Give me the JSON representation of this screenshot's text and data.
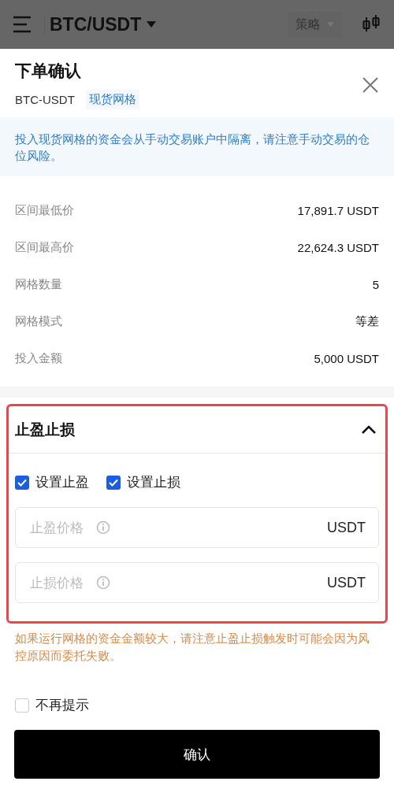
{
  "top_bar": {
    "pair": "BTC/USDT",
    "mode": "策略"
  },
  "dialog": {
    "title": "下单确认",
    "symbol": "BTC-USDT",
    "tag": "现货网格",
    "notice": "投入现货网格的资金会从手动交易账户中隔离，请注意手动交易的仓位风险。"
  },
  "details": [
    {
      "label": "区间最低价",
      "value": "17,891.7 USDT"
    },
    {
      "label": "区间最高价",
      "value": "22,624.3 USDT"
    },
    {
      "label": "网格数量",
      "value": "5"
    },
    {
      "label": "网格模式",
      "value": "等差"
    },
    {
      "label": "投入金额",
      "value": "5,000 USDT"
    }
  ],
  "tp_sl": {
    "title": "止盈止损",
    "expanded": true,
    "highlighted": true,
    "options": [
      {
        "label": "设置止盈",
        "checked": true
      },
      {
        "label": "设置止损",
        "checked": true
      }
    ],
    "fields": [
      {
        "placeholder": "止盈价格",
        "unit": "USDT"
      },
      {
        "placeholder": "止损价格",
        "unit": "USDT"
      }
    ]
  },
  "warning": "如果运行网格的资金金额较大，请注意止盈止损触发时可能会因为风控原因而委托失败。",
  "dont_remind": {
    "label": "不再提示",
    "checked": false
  },
  "confirm_button": "确认"
}
